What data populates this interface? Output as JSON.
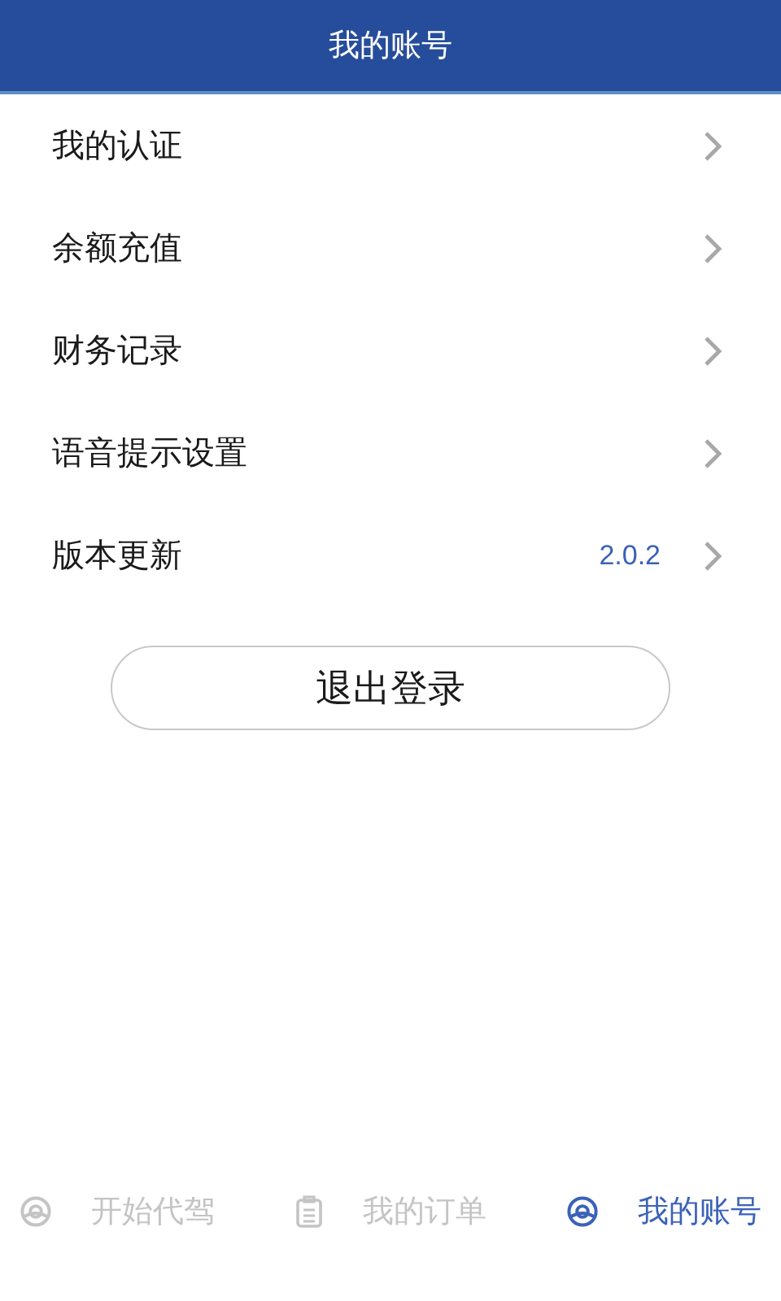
{
  "header": {
    "title": "我的账号"
  },
  "menu": [
    {
      "label": "我的认证"
    },
    {
      "label": "余额充值"
    },
    {
      "label": "财务记录"
    },
    {
      "label": "语音提示设置"
    },
    {
      "label": "版本更新",
      "value": "2.0.2"
    }
  ],
  "logout_button": "退出登录",
  "tabs": [
    {
      "kind": "wheel",
      "label": "开始代驾",
      "selected": false
    },
    {
      "kind": "clipboard",
      "label": "我的订单",
      "selected": false
    },
    {
      "kind": "wheel",
      "label": "我的账号",
      "selected": true
    }
  ]
}
